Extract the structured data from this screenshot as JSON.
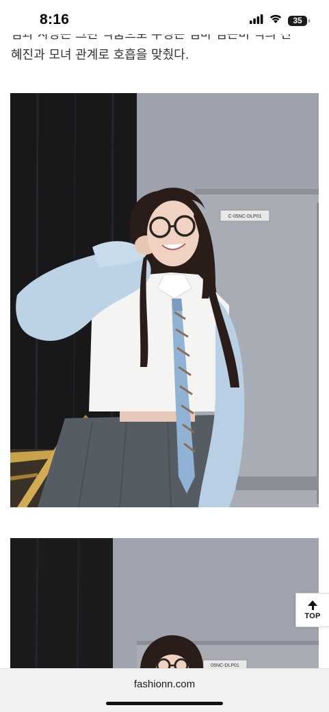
{
  "status_bar": {
    "time": "8:16",
    "battery_level": "35"
  },
  "article": {
    "partial_line": "엄과 사랑은 그린 덕품으로 우정은 엄마 엄은비 역의 진",
    "line_2": "혜진과 모녀 관계로 호흡을 맞췄다."
  },
  "photos": [
    {
      "icon": "photo-woman-glasses-school-uniform",
      "door_label": "C-05NC-DLP01"
    },
    {
      "icon": "photo-woman-glasses-partial",
      "door_label": "05NC-DLP01"
    }
  ],
  "scroll_top_button": {
    "label": "TOP"
  },
  "browser": {
    "address": "fashionn.com"
  },
  "colors": {
    "sweater": "#bcd3e6",
    "skirt": "#555b63",
    "tie_blue": "#8fb4d8",
    "background_wall": "#9fa3ad",
    "curtain": "#1a1a1c"
  }
}
